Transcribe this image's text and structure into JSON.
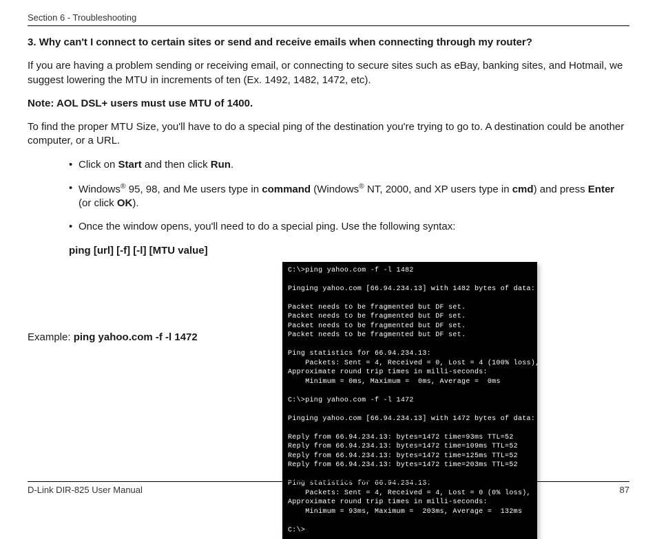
{
  "header": {
    "section": "Section 6 - Troubleshooting"
  },
  "q": {
    "num": "3.",
    "text": "Why can't I connect to certain sites or send and receive emails when connecting through my router?"
  },
  "p1": "If you are having a problem sending or receiving email, or connecting to secure sites such as eBay, banking sites, and Hotmail, we suggest lowering the MTU in increments of ten (Ex. 1492, 1482, 1472, etc).",
  "note": "Note: AOL DSL+ users must use MTU of 1400.",
  "p2": "To find the proper MTU Size, you'll have to do a special ping of the destination you're trying to go to. A destination could be another computer, or a URL.",
  "b1": {
    "pre": "Click on ",
    "s1": "Start",
    "mid": " and then click ",
    "s2": "Run",
    "post": "."
  },
  "b2": {
    "pre": "Windows",
    "reg": "®",
    "a": " 95, 98, and Me users type in ",
    "cmd1": "command",
    "b": " (Windows",
    "c": " NT, 2000, and XP users type in ",
    "cmd2": "cmd",
    "d": ") and press ",
    "enter": "Enter",
    "e": " (or click ",
    "ok": "OK",
    "f": ")."
  },
  "b3": "Once the window opens, you'll need to do a special ping. Use the following syntax:",
  "syntax": "ping [url] [-f] [-l] [MTU value]",
  "example": {
    "label": "Example: ",
    "cmd": "ping yahoo.com -f -l 1472"
  },
  "term": [
    "C:\\>ping yahoo.com -f -l 1482",
    "",
    "Pinging yahoo.com [66.94.234.13] with 1482 bytes of data:",
    "",
    "Packet needs to be fragmented but DF set.",
    "Packet needs to be fragmented but DF set.",
    "Packet needs to be fragmented but DF set.",
    "Packet needs to be fragmented but DF set.",
    "",
    "Ping statistics for 66.94.234.13:",
    "    Packets: Sent = 4, Received = 0, Lost = 4 (100% loss),",
    "Approximate round trip times in milli-seconds:",
    "    Minimum = 0ms, Maximum =  0ms, Average =  0ms",
    "",
    "C:\\>ping yahoo.com -f -l 1472",
    "",
    "Pinging yahoo.com [66.94.234.13] with 1472 bytes of data:",
    "",
    "Reply from 66.94.234.13: bytes=1472 time=93ms TTL=52",
    "Reply from 66.94.234.13: bytes=1472 time=109ms TTL=52",
    "Reply from 66.94.234.13: bytes=1472 time=125ms TTL=52",
    "Reply from 66.94.234.13: bytes=1472 time=203ms TTL=52",
    "",
    "Ping statistics for 66.94.234.13:",
    "    Packets: Sent = 4, Received = 4, Lost = 0 (0% loss),",
    "Approximate round trip times in milli-seconds:",
    "    Minimum = 93ms, Maximum =  203ms, Average =  132ms",
    "",
    "C:\\>"
  ],
  "footer": {
    "left": "D-Link DIR-825 User Manual",
    "right": "87"
  }
}
